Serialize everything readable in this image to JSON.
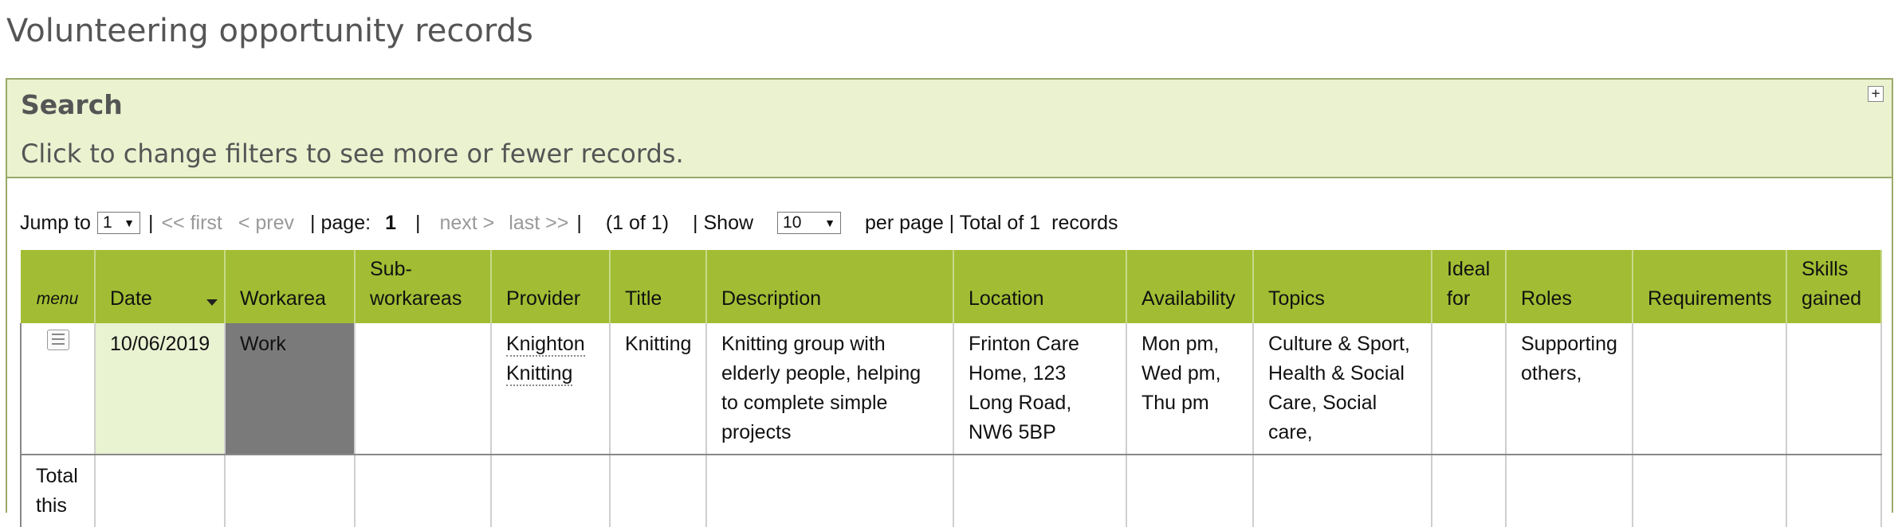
{
  "page_title": "Volunteering opportunity records",
  "search": {
    "title": "Search",
    "hint": "Click to change filters to see more or fewer records.",
    "expand_icon": "+"
  },
  "pager": {
    "jump_label": "Jump to",
    "jump_value": "1",
    "sep": "|",
    "first": "<< first",
    "prev": "< prev",
    "page_label": "| page:",
    "page_number": "1",
    "next": "next >",
    "last": "last >>",
    "of": "(1 of 1)",
    "show_label": "| Show",
    "per_page_value": "10",
    "per_page_label": "per page | Total of 1",
    "records_label": "records"
  },
  "table": {
    "headers": {
      "menu": "menu",
      "date": "Date",
      "workarea": "Workarea",
      "subworkareas": "Sub-workareas",
      "provider": "Provider",
      "title": "Title",
      "description": "Description",
      "location": "Location",
      "availability": "Availability",
      "topics": "Topics",
      "ideal_for": "Ideal for",
      "roles": "Roles",
      "requirements": "Requirements",
      "skills_gained": "Skills gained"
    },
    "row": {
      "date": "10/06/2019",
      "workarea": "Work",
      "subworkareas": "",
      "provider": "Knighton Knitting",
      "title": "Knitting",
      "description": "Knitting group with elderly people, helping to complete simple projects",
      "location": "Frinton Care Home, 123 Long Road, NW6 5BP",
      "availability": "Mon pm, Wed pm, Thu pm",
      "topics": "Culture & Sport, Health & Social Care, Social care,",
      "ideal_for": "",
      "roles": "Supporting others,",
      "requirements": "",
      "skills_gained": ""
    },
    "total_label": "Total this"
  },
  "colors": {
    "header_bg": "#a2bd33",
    "search_bg": "#eaf2d0",
    "date_cell_bg": "#e9f2d1",
    "workarea_cell_bg": "#7a7a7a"
  }
}
